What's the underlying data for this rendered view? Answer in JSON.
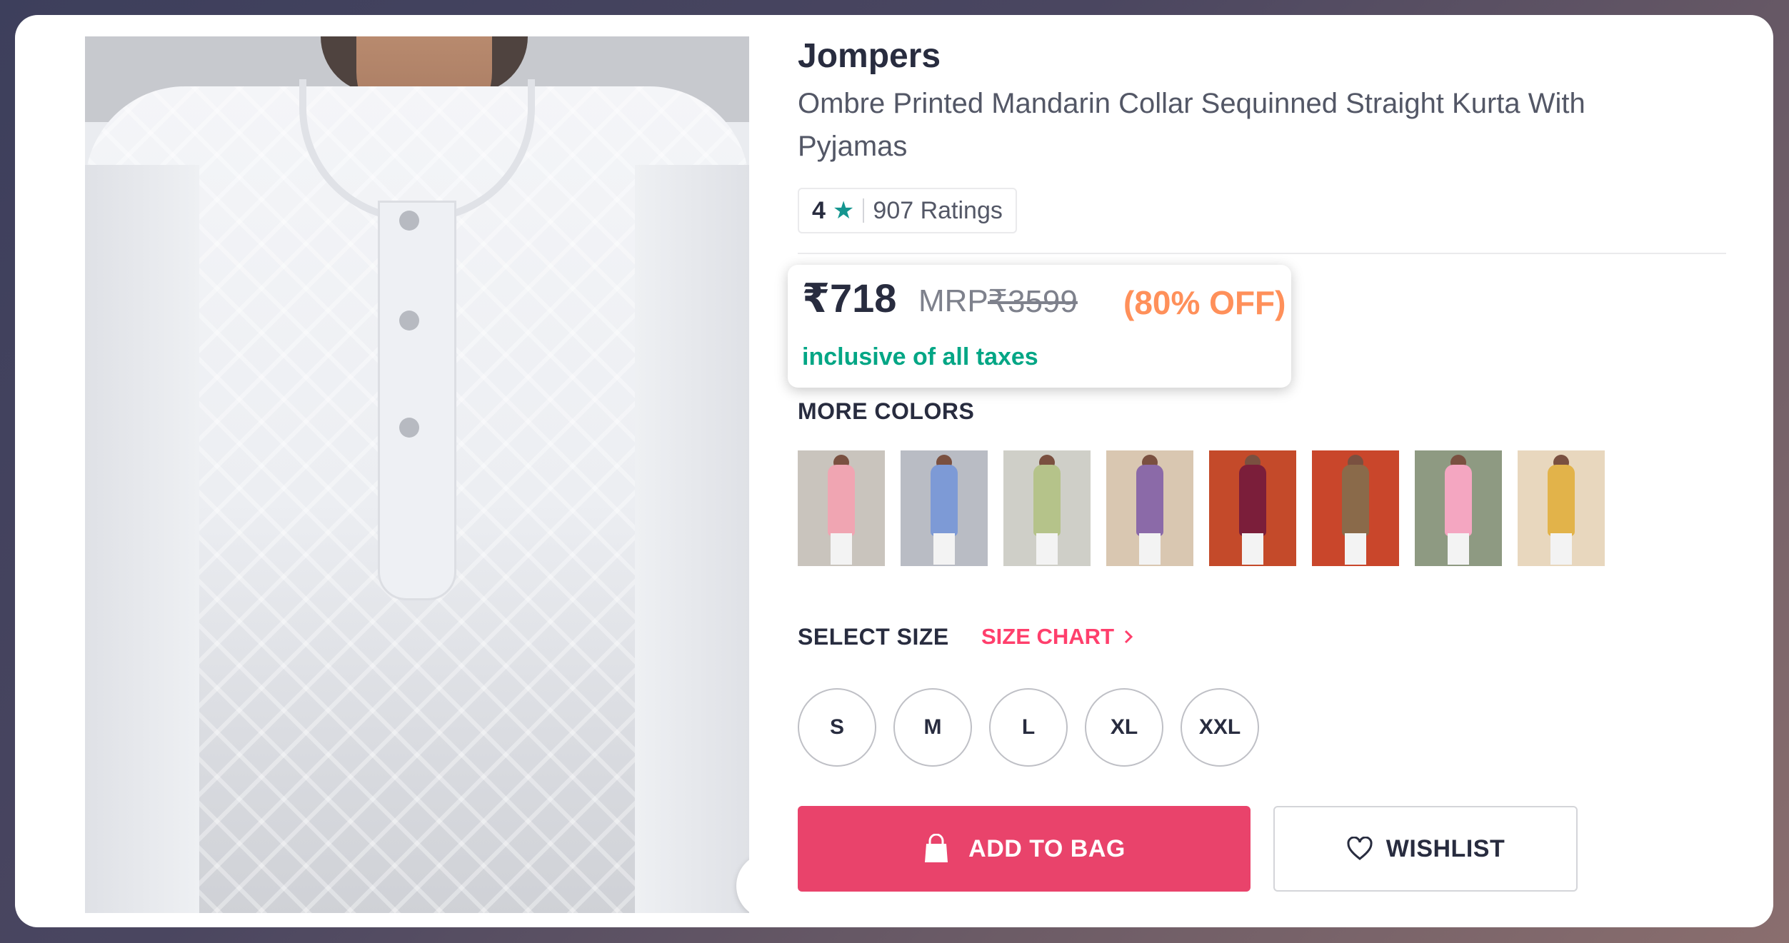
{
  "product": {
    "brand": "Jompers",
    "title": "Ombre Printed Mandarin Collar Sequinned Straight Kurta With Pyjamas",
    "rating": {
      "value": "4",
      "count_label": "907 Ratings"
    },
    "price": {
      "current": "₹718",
      "mrp_label": "MRP",
      "mrp": "₹3599",
      "discount": "(80% OFF)",
      "tax_note": "inclusive of all taxes"
    }
  },
  "colors": {
    "heading": "MORE COLORS",
    "swatches": [
      {
        "name": "pink",
        "bg": "#c9c4bd",
        "kurta": "#f0a5b2"
      },
      {
        "name": "blue",
        "bg": "#b9bcc4",
        "kurta": "#7d9ad6"
      },
      {
        "name": "green",
        "bg": "#cfcfc8",
        "kurta": "#b5c38a"
      },
      {
        "name": "purple",
        "bg": "#d9c7b1",
        "kurta": "#8b6aa8"
      },
      {
        "name": "maroon",
        "bg": "#c44a2a",
        "kurta": "#7b1e3a"
      },
      {
        "name": "brown",
        "bg": "#c9462b",
        "kurta": "#8a6a4a"
      },
      {
        "name": "white-pink",
        "bg": "#8e9a82",
        "kurta": "#f4a6c1"
      },
      {
        "name": "mustard",
        "bg": "#e8d7be",
        "kurta": "#e2b34a"
      }
    ]
  },
  "sizes": {
    "heading": "SELECT SIZE",
    "chart_label": "SIZE CHART",
    "options": [
      "S",
      "M",
      "L",
      "XL",
      "XXL"
    ]
  },
  "actions": {
    "add_to_bag": "ADD TO BAG",
    "wishlist": "WISHLIST"
  },
  "colors_theme": {
    "primary": "#e9436b",
    "accent_green": "#03a685",
    "discount": "#ff905a",
    "rating_star": "#14958f"
  }
}
